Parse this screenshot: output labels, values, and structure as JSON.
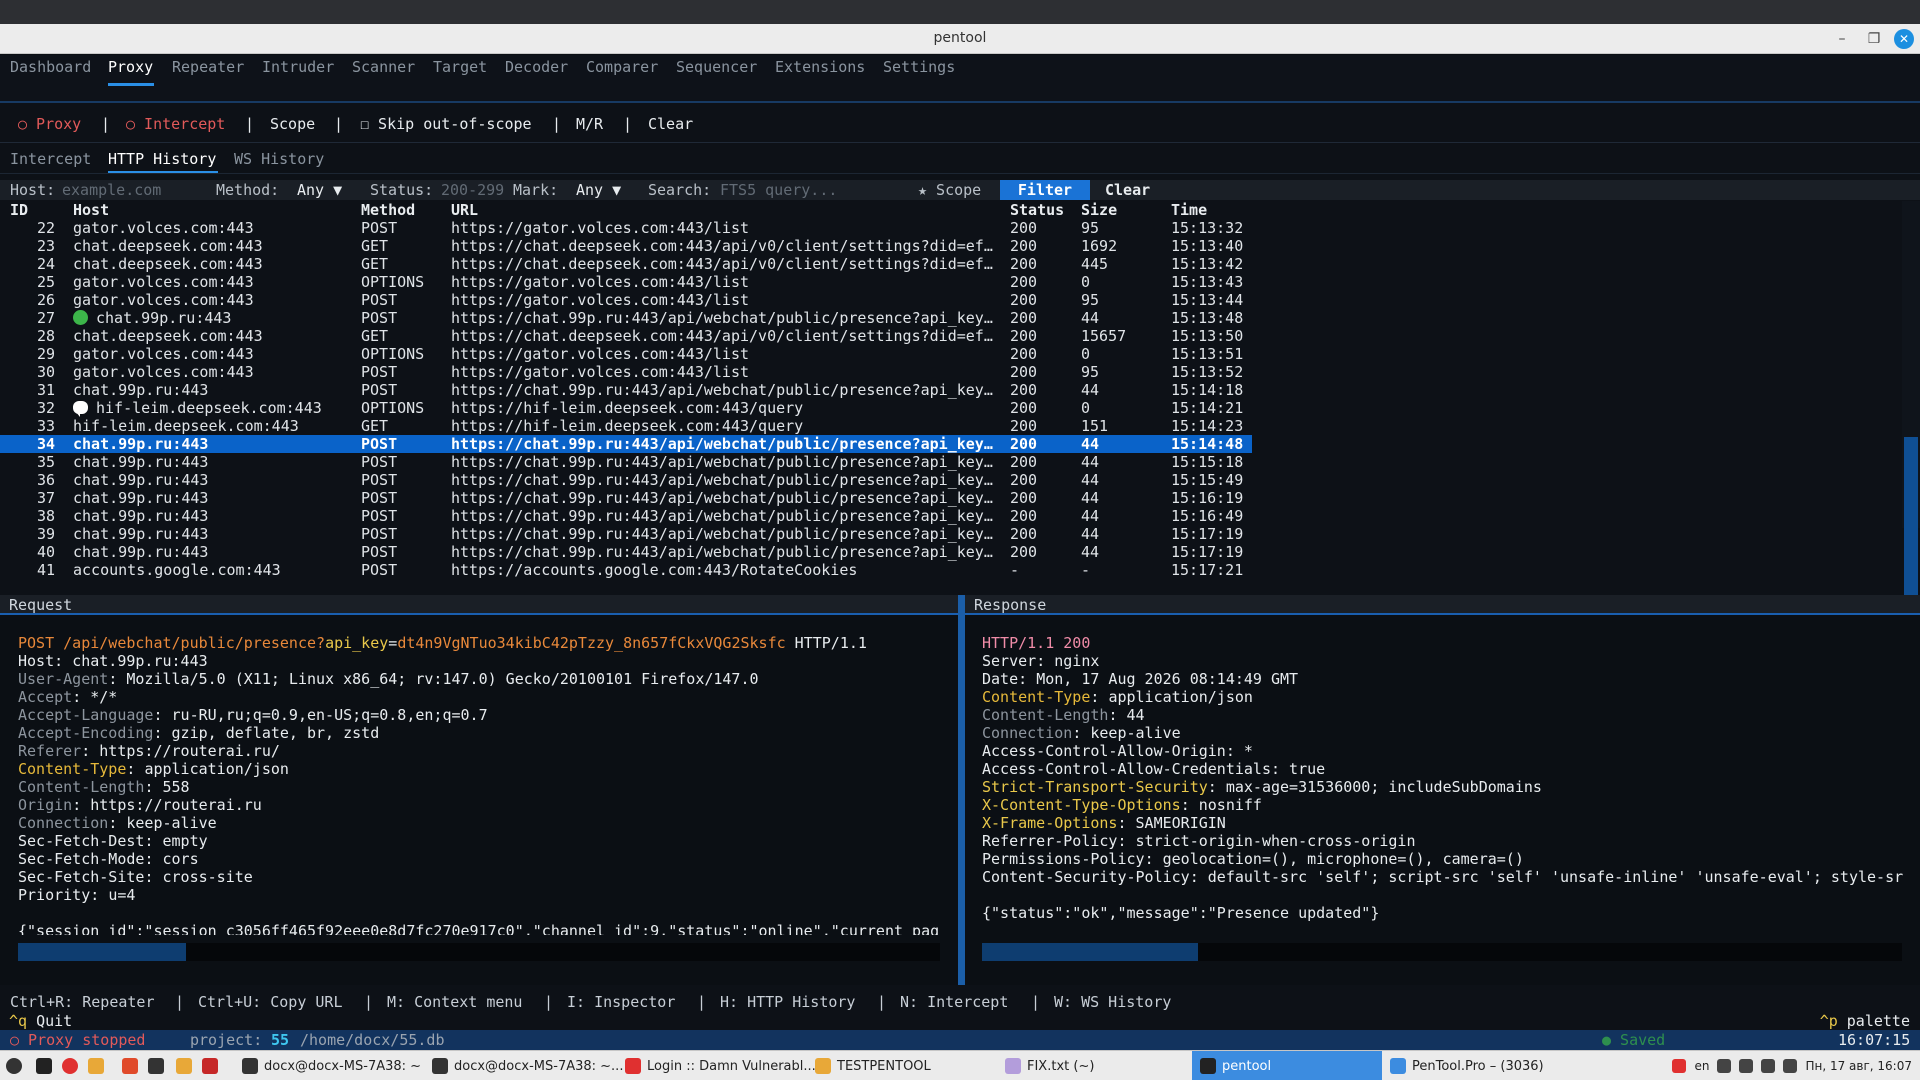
{
  "window": {
    "title": "pentool",
    "minimize": "–",
    "maximize": "❐",
    "close": "✕"
  },
  "mainnav": [
    "Dashboard",
    "Proxy",
    "Repeater",
    "Intruder",
    "Scanner",
    "Target",
    "Decoder",
    "Comparer",
    "Sequencer",
    "Extensions",
    "Settings"
  ],
  "toolbar": {
    "proxy": "○ Proxy",
    "intercept": "○ Intercept",
    "scope": "Scope",
    "skip": "☐ Skip out-of-scope",
    "mr": "M/R",
    "clear": "Clear",
    "sep": "|"
  },
  "subtabs": [
    "Intercept",
    "HTTP History",
    "WS History"
  ],
  "filter": {
    "host_label": "Host:",
    "host_placeholder": "example.com",
    "method_label": "Method:",
    "method_value": "Any ▼",
    "status_label": "Status:",
    "status_placeholder": "200-299",
    "mark_label": "Mark:",
    "mark_value": "Any ▼",
    "search_label": "Search:",
    "search_placeholder": "FTS5 query...",
    "scope": "★ Scope",
    "filter_btn": "Filter",
    "clear_btn": "Clear"
  },
  "table": {
    "headers": {
      "id": "ID",
      "host": "Host",
      "method": "Method",
      "url": "URL",
      "status": "Status",
      "size": "Size",
      "time": "Time"
    },
    "rows": [
      {
        "id": "22",
        "host": "gator.volces.com:443",
        "method": "POST",
        "url": "https://gator.volces.com:443/list",
        "status": "200",
        "size": "95",
        "time": "15:13:32"
      },
      {
        "id": "23",
        "host": "chat.deepseek.com:443",
        "method": "GET",
        "url": "https://chat.deepseek.com:443/api/v0/client/settings?did=ef…",
        "status": "200",
        "size": "1692",
        "time": "15:13:40"
      },
      {
        "id": "24",
        "host": "chat.deepseek.com:443",
        "method": "GET",
        "url": "https://chat.deepseek.com:443/api/v0/client/settings?did=ef…",
        "status": "200",
        "size": "445",
        "time": "15:13:42"
      },
      {
        "id": "25",
        "host": "gator.volces.com:443",
        "method": "OPTIONS",
        "url": "https://gator.volces.com:443/list",
        "status": "200",
        "size": "0",
        "time": "15:13:43"
      },
      {
        "id": "26",
        "host": "gator.volces.com:443",
        "method": "POST",
        "url": "https://gator.volces.com:443/list",
        "status": "200",
        "size": "95",
        "time": "15:13:44"
      },
      {
        "id": "27",
        "host": "chat.99p.ru:443",
        "method": "POST",
        "url": "https://chat.99p.ru:443/api/webchat/public/presence?api_key…",
        "status": "200",
        "size": "44",
        "time": "15:13:48",
        "marker": "green-dot"
      },
      {
        "id": "28",
        "host": "chat.deepseek.com:443",
        "method": "GET",
        "url": "https://chat.deepseek.com:443/api/v0/client/settings?did=ef…",
        "status": "200",
        "size": "15657",
        "time": "15:13:50"
      },
      {
        "id": "29",
        "host": "gator.volces.com:443",
        "method": "OPTIONS",
        "url": "https://gator.volces.com:443/list",
        "status": "200",
        "size": "0",
        "time": "15:13:51"
      },
      {
        "id": "30",
        "host": "gator.volces.com:443",
        "method": "POST",
        "url": "https://gator.volces.com:443/list",
        "status": "200",
        "size": "95",
        "time": "15:13:52"
      },
      {
        "id": "31",
        "host": "chat.99p.ru:443",
        "method": "POST",
        "url": "https://chat.99p.ru:443/api/webchat/public/presence?api_key…",
        "status": "200",
        "size": "44",
        "time": "15:14:18"
      },
      {
        "id": "32",
        "host": "hif-leim.deepseek.com:443",
        "method": "OPTIONS",
        "url": "https://hif-leim.deepseek.com:443/query",
        "status": "200",
        "size": "0",
        "time": "15:14:21",
        "marker": "chat-bubble"
      },
      {
        "id": "33",
        "host": "hif-leim.deepseek.com:443",
        "method": "GET",
        "url": "https://hif-leim.deepseek.com:443/query",
        "status": "200",
        "size": "151",
        "time": "15:14:23"
      },
      {
        "id": "34",
        "host": "chat.99p.ru:443",
        "method": "POST",
        "url": "https://chat.99p.ru:443/api/webchat/public/presence?api_key…",
        "status": "200",
        "size": "44",
        "time": "15:14:48",
        "selected": true
      },
      {
        "id": "35",
        "host": "chat.99p.ru:443",
        "method": "POST",
        "url": "https://chat.99p.ru:443/api/webchat/public/presence?api_key…",
        "status": "200",
        "size": "44",
        "time": "15:15:18"
      },
      {
        "id": "36",
        "host": "chat.99p.ru:443",
        "method": "POST",
        "url": "https://chat.99p.ru:443/api/webchat/public/presence?api_key…",
        "status": "200",
        "size": "44",
        "time": "15:15:49"
      },
      {
        "id": "37",
        "host": "chat.99p.ru:443",
        "method": "POST",
        "url": "https://chat.99p.ru:443/api/webchat/public/presence?api_key…",
        "status": "200",
        "size": "44",
        "time": "15:16:19"
      },
      {
        "id": "38",
        "host": "chat.99p.ru:443",
        "method": "POST",
        "url": "https://chat.99p.ru:443/api/webchat/public/presence?api_key…",
        "status": "200",
        "size": "44",
        "time": "15:16:49"
      },
      {
        "id": "39",
        "host": "chat.99p.ru:443",
        "method": "POST",
        "url": "https://chat.99p.ru:443/api/webchat/public/presence?api_key…",
        "status": "200",
        "size": "44",
        "time": "15:17:19"
      },
      {
        "id": "40",
        "host": "chat.99p.ru:443",
        "method": "POST",
        "url": "https://chat.99p.ru:443/api/webchat/public/presence?api_key…",
        "status": "200",
        "size": "44",
        "time": "15:17:19"
      },
      {
        "id": "41",
        "host": "accounts.google.com:443",
        "method": "POST",
        "url": "https://accounts.google.com:443/RotateCookies",
        "status": "-",
        "size": "-",
        "time": "15:17:21"
      }
    ]
  },
  "request": {
    "title": "Request",
    "request_line": {
      "method": "POST ",
      "path": "/api/webchat/public/presence?",
      "param": "api_key",
      "eq": "=",
      "value": "dt4n9VgNTuo34kibC42pTzzy_8n657fCkxVQG2Sksfc",
      "version": " HTTP/1.1"
    },
    "headers": [
      {
        "name": "Host",
        "value": "chat.99p.ru:443",
        "style": "white"
      },
      {
        "name": "User-Agent",
        "value": "Mozilla/5.0 (X11; Linux x86_64; rv:147.0) Gecko/20100101 Firefox/147.0",
        "style": "grey"
      },
      {
        "name": "Accept",
        "value": "*/*",
        "style": "grey"
      },
      {
        "name": "Accept-Language",
        "value": "ru-RU,ru;q=0.9,en-US;q=0.8,en;q=0.7",
        "style": "grey"
      },
      {
        "name": "Accept-Encoding",
        "value": "gzip, deflate, br, zstd",
        "style": "grey"
      },
      {
        "name": "Referer",
        "value": "https://routerai.ru/",
        "style": "grey"
      },
      {
        "name": "Content-Type",
        "value": "application/json",
        "style": "gold"
      },
      {
        "name": "Content-Length",
        "value": "558",
        "style": "grey"
      },
      {
        "name": "Origin",
        "value": "https://routerai.ru",
        "style": "grey"
      },
      {
        "name": "Connection",
        "value": "keep-alive",
        "style": "grey"
      },
      {
        "name": "Sec-Fetch-Dest",
        "value": "empty",
        "style": "white"
      },
      {
        "name": "Sec-Fetch-Mode",
        "value": "cors",
        "style": "white"
      },
      {
        "name": "Sec-Fetch-Site",
        "value": "cross-site",
        "style": "white"
      },
      {
        "name": "Priority",
        "value": "u=4",
        "style": "white"
      }
    ],
    "body": "{\"session_id\":\"session_c3056ff465f92eee0e8d7fc270e917c0\",\"channel_id\":9,\"status\":\"online\",\"current_pag"
  },
  "response": {
    "title": "Response",
    "status_line": "HTTP/1.1 200",
    "headers": [
      {
        "name": "Server",
        "value": "nginx",
        "style": "white"
      },
      {
        "name": "Date",
        "value": "Mon, 17 Aug 2026 08:14:49 GMT",
        "style": "white"
      },
      {
        "name": "Content-Type",
        "value": "application/json",
        "style": "gold"
      },
      {
        "name": "Content-Length",
        "value": "44",
        "style": "grey"
      },
      {
        "name": "Connection",
        "value": "keep-alive",
        "style": "grey"
      },
      {
        "name": "Access-Control-Allow-Origin",
        "value": "*",
        "style": "white"
      },
      {
        "name": "Access-Control-Allow-Credentials",
        "value": "true",
        "style": "white"
      },
      {
        "name": "Strict-Transport-Security",
        "value": "max-age=31536000; includeSubDomains",
        "style": "yellow"
      },
      {
        "name": "X-Content-Type-Options",
        "value": "nosniff",
        "style": "yellow"
      },
      {
        "name": "X-Frame-Options",
        "value": "SAMEORIGIN",
        "style": "yellow"
      },
      {
        "name": "Referrer-Policy",
        "value": "strict-origin-when-cross-origin",
        "style": "white"
      },
      {
        "name": "Permissions-Policy",
        "value": "geolocation=(), microphone=(), camera=()",
        "style": "white"
      },
      {
        "name": "Content-Security-Policy",
        "value": "default-src 'self'; script-src 'self' 'unsafe-inline' 'unsafe-eval'; style-sr",
        "style": "white"
      }
    ],
    "body": "{\"status\":\"ok\",\"message\":\"Presence updated\"}"
  },
  "shortcuts": [
    "Ctrl+R: Repeater",
    "|",
    "Ctrl+U: Copy URL",
    "|",
    "M: Context menu",
    "|",
    "I: Inspector",
    "|",
    "H: HTTP History",
    "|",
    "N: Intercept",
    "|",
    "W: WS History"
  ],
  "quitline": {
    "key": "^q",
    "label": " Quit",
    "palette_key": "^p",
    "palette_label": " palette"
  },
  "statusbar": {
    "proxy": "○ Proxy stopped",
    "project_label": "project:",
    "project_num": "55",
    "project_path": "/home/docx/55.db",
    "saved": "● Saved",
    "time": "16:07:15"
  },
  "taskbar": {
    "items": [
      {
        "label": "docx@docx-MS-7A38: ~"
      },
      {
        "label": "docx@docx-MS-7A38: ~..."
      },
      {
        "label": "Login :: Damn Vulnerabl..."
      },
      {
        "label": "TESTPENTOOL"
      },
      {
        "label": "FIX.txt (~)"
      },
      {
        "label": "pentool",
        "active": true
      },
      {
        "label": "PenTool.Pro – (3036)"
      }
    ],
    "lang": "en",
    "clock": "Пн, 17 авг, 16:07"
  },
  "colors": {
    "accent": "#1a73d6",
    "selected_row": "#0a63c9",
    "status_bar": "#12335e",
    "red": "#e25a5a"
  }
}
